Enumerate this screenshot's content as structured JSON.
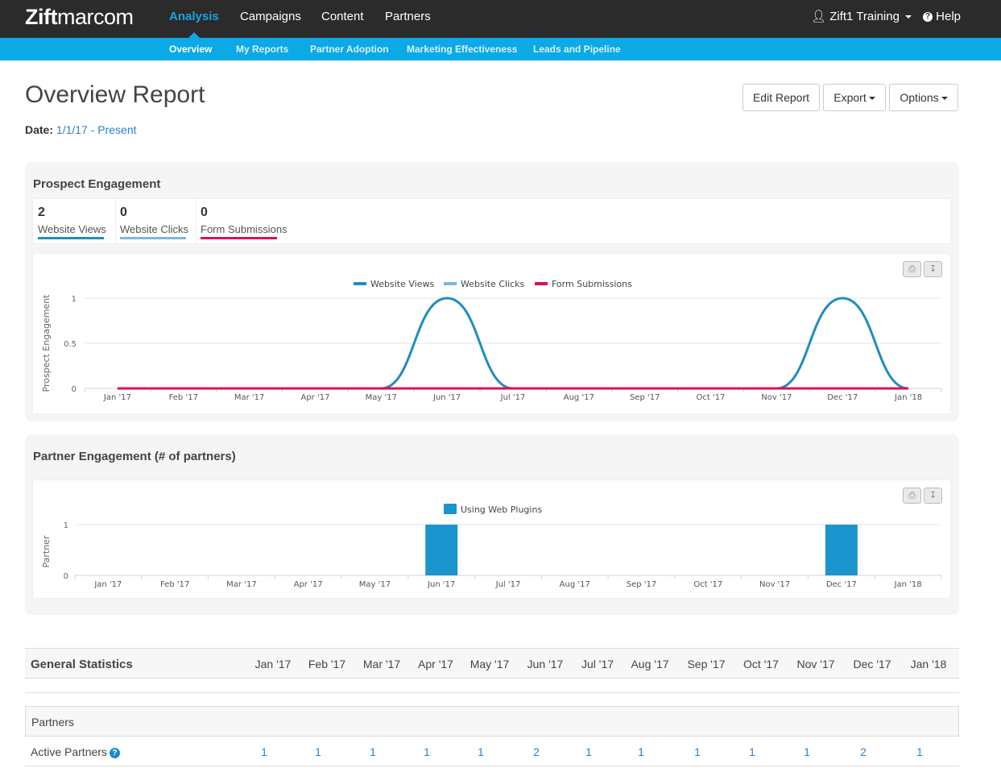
{
  "app": {
    "logo_bold": "Zift",
    "logo_light": "marcom"
  },
  "topnav": [
    {
      "label": "Analysis",
      "active": true
    },
    {
      "label": "Campaigns"
    },
    {
      "label": "Content"
    },
    {
      "label": "Partners"
    }
  ],
  "user": {
    "name": "Zift1 Training",
    "help": "Help"
  },
  "subnav": [
    {
      "label": "Overview",
      "active": true
    },
    {
      "label": "My Reports"
    },
    {
      "label": "Partner Adoption"
    },
    {
      "label": "Marketing Effectiveness"
    },
    {
      "label": "Leads and Pipeline"
    }
  ],
  "page": {
    "title": "Overview Report",
    "date_label": "Date:",
    "date_value": "1/1/17 - Present",
    "buttons": {
      "edit": "Edit Report",
      "export": "Export",
      "options": "Options"
    }
  },
  "prospect": {
    "title": "Prospect Engagement",
    "stats": [
      {
        "value": "2",
        "label": "Website Views",
        "color": "#1f8dbf"
      },
      {
        "value": "0",
        "label": "Website Clicks",
        "color": "#7ab8dc"
      },
      {
        "value": "0",
        "label": "Form Submissions",
        "color": "#e0104f"
      }
    ]
  },
  "partner": {
    "title": "Partner Engagement (# of partners)"
  },
  "chart_data": [
    {
      "type": "line",
      "ylabel": "Prospect Engagement",
      "categories": [
        "Jan '17",
        "Feb '17",
        "Mar '17",
        "Apr '17",
        "May '17",
        "Jun '17",
        "Jul '17",
        "Aug '17",
        "Sep '17",
        "Oct '17",
        "Nov '17",
        "Dec '17",
        "Jan '18"
      ],
      "yticks": [
        "0",
        "0.5",
        "1"
      ],
      "ylim": [
        0,
        1
      ],
      "legend": "top-center",
      "series": [
        {
          "name": "Website Views",
          "color": "#1f8dbf",
          "values": [
            0,
            0,
            0,
            0,
            0,
            1,
            0,
            0,
            0,
            0,
            0,
            1,
            0
          ]
        },
        {
          "name": "Website Clicks",
          "color": "#7ab8dc",
          "values": [
            0,
            0,
            0,
            0,
            0,
            0,
            0,
            0,
            0,
            0,
            0,
            0,
            0
          ]
        },
        {
          "name": "Form Submissions",
          "color": "#e0104f",
          "values": [
            0,
            0,
            0,
            0,
            0,
            0,
            0,
            0,
            0,
            0,
            0,
            0,
            0
          ]
        }
      ]
    },
    {
      "type": "bar",
      "ylabel": "Partner",
      "categories": [
        "Jan '17",
        "Feb '17",
        "Mar '17",
        "Apr '17",
        "May '17",
        "Jun '17",
        "Jul '17",
        "Aug '17",
        "Sep '17",
        "Oct '17",
        "Nov '17",
        "Dec '17",
        "Jan '18"
      ],
      "yticks": [
        "0",
        "1"
      ],
      "ylim": [
        0,
        1
      ],
      "legend": "top-center",
      "series": [
        {
          "name": "Using Web Plugins",
          "color": "#1b95cd",
          "values": [
            0,
            0,
            0,
            0,
            0,
            1,
            0,
            0,
            0,
            0,
            0,
            1,
            0
          ]
        }
      ]
    }
  ],
  "stats_table": {
    "title": "General Statistics",
    "months": [
      "Jan '17",
      "Feb '17",
      "Mar '17",
      "Apr '17",
      "May '17",
      "Jun '17",
      "Jul '17",
      "Aug '17",
      "Sep '17",
      "Oct '17",
      "Nov '17",
      "Dec '17",
      "Jan '18"
    ],
    "section": "Partners",
    "row_label": "Active Partners",
    "row_values": [
      "1",
      "1",
      "1",
      "1",
      "1",
      "2",
      "1",
      "1",
      "1",
      "1",
      "1",
      "2",
      "1"
    ]
  }
}
